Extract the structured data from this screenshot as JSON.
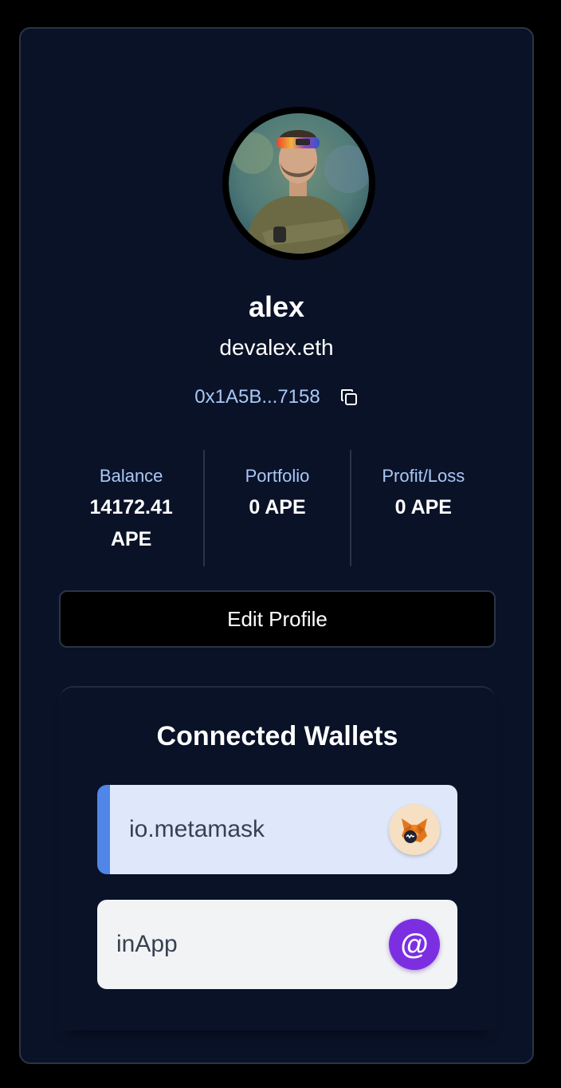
{
  "profile": {
    "name": "alex",
    "ens": "devalex.eth",
    "address": "0x1A5B...7158",
    "avatar_icon": "avatar-photo"
  },
  "stats": [
    {
      "label": "Balance",
      "value": "14172.41 APE"
    },
    {
      "label": "Portfolio",
      "value": "0 APE"
    },
    {
      "label": "Profit/Loss",
      "value": "0 APE"
    }
  ],
  "actions": {
    "edit_profile_label": "Edit Profile"
  },
  "wallets": {
    "title": "Connected Wallets",
    "items": [
      {
        "label": "io.metamask",
        "icon": "metamask-fox-icon",
        "active": true
      },
      {
        "label": "inApp",
        "icon": "at-sign-icon",
        "symbol": "@",
        "active": false
      }
    ]
  },
  "colors": {
    "background": "#000000",
    "card": "#0a1228",
    "accent": "#a9c8f5",
    "active_wallet_bg": "#dfe8fa",
    "active_wallet_bar": "#4f86e8",
    "inapp_icon_bg": "#7c2fe0"
  }
}
